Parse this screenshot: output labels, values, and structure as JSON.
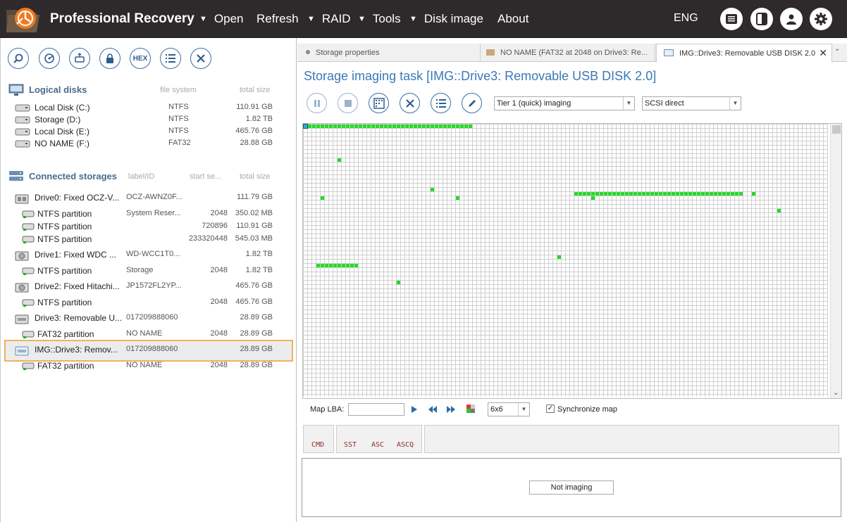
{
  "app": {
    "title": "Professional Recovery"
  },
  "menu": {
    "open": "Open",
    "refresh": "Refresh",
    "raid": "RAID",
    "tools": "Tools",
    "disk_image": "Disk image",
    "about": "About",
    "lang": "ENG"
  },
  "left_toolbar": {
    "hex": "HEX"
  },
  "logical": {
    "header": "Logical disks",
    "col_fs": "file system",
    "col_size": "total size",
    "items": [
      {
        "name": "Local Disk (C:)",
        "fs": "NTFS",
        "size": "110.91 GB"
      },
      {
        "name": "Storage (D:)",
        "fs": "NTFS",
        "size": "1.82 TB"
      },
      {
        "name": "Local Disk (E:)",
        "fs": "NTFS",
        "size": "465.76 GB"
      },
      {
        "name": "NO NAME (F:)",
        "fs": "FAT32",
        "size": "28.88 GB"
      }
    ]
  },
  "storages": {
    "header": "Connected storages",
    "col_label": "label/ID",
    "col_start": "start se...",
    "col_size": "total size",
    "items": [
      {
        "name": "Drive0: Fixed OCZ-V...",
        "label": "OCZ-AWNZ0F...",
        "start": "",
        "size": "111.79 GB"
      },
      {
        "name": "NTFS partition",
        "label": "System Reser...",
        "start": "2048",
        "size": "350.02 MB"
      },
      {
        "name": "NTFS partition",
        "label": "",
        "start": "720896",
        "size": "110.91 GB"
      },
      {
        "name": "NTFS partition",
        "label": "",
        "start": "233320448",
        "size": "545.03 MB"
      },
      {
        "name": "Drive1: Fixed WDC ...",
        "label": "WD-WCC1T0...",
        "start": "",
        "size": "1.82 TB"
      },
      {
        "name": "NTFS partition",
        "label": "Storage",
        "start": "2048",
        "size": "1.82 TB"
      },
      {
        "name": "Drive2: Fixed Hitachi...",
        "label": "JP1572FL2YP...",
        "start": "",
        "size": "465.76 GB"
      },
      {
        "name": "NTFS partition",
        "label": "",
        "start": "2048",
        "size": "465.76 GB"
      },
      {
        "name": "Drive3: Removable U...",
        "label": "017209888060",
        "start": "",
        "size": "28.89 GB"
      },
      {
        "name": "FAT32 partition",
        "label": "NO NAME",
        "start": "2048",
        "size": "28.89 GB"
      },
      {
        "name": "IMG::Drive3: Remov...",
        "label": "017209888060",
        "start": "",
        "size": "28.89 GB"
      },
      {
        "name": "FAT32 partition",
        "label": "NO NAME",
        "start": "2048",
        "size": "28.89 GB"
      }
    ]
  },
  "tabs": [
    {
      "label": "Storage properties"
    },
    {
      "label": "NO NAME (FAT32 at 2048 on Drive3: Re..."
    },
    {
      "label": "IMG::Drive3: Removable USB DISK 2.0"
    }
  ],
  "task": {
    "title": "Storage imaging task [IMG::Drive3: Removable USB DISK 2.0]",
    "mode": "Tier 1 (quick) imaging",
    "access": "SCSI direct"
  },
  "map": {
    "lba_label": "Map LBA:",
    "lba_value": "",
    "cell_size": "6x6",
    "sync_label": "Synchronize map",
    "sync_checked": true
  },
  "cmd": {
    "cmd": "CMD",
    "sst": "SST",
    "asc": "ASC",
    "ascq": "ASCQ"
  },
  "status": {
    "text": "Not imaging"
  },
  "colors": {
    "accent": "#3b79b6",
    "map_ok": "#22dd22",
    "selection": "#e9b55c"
  }
}
